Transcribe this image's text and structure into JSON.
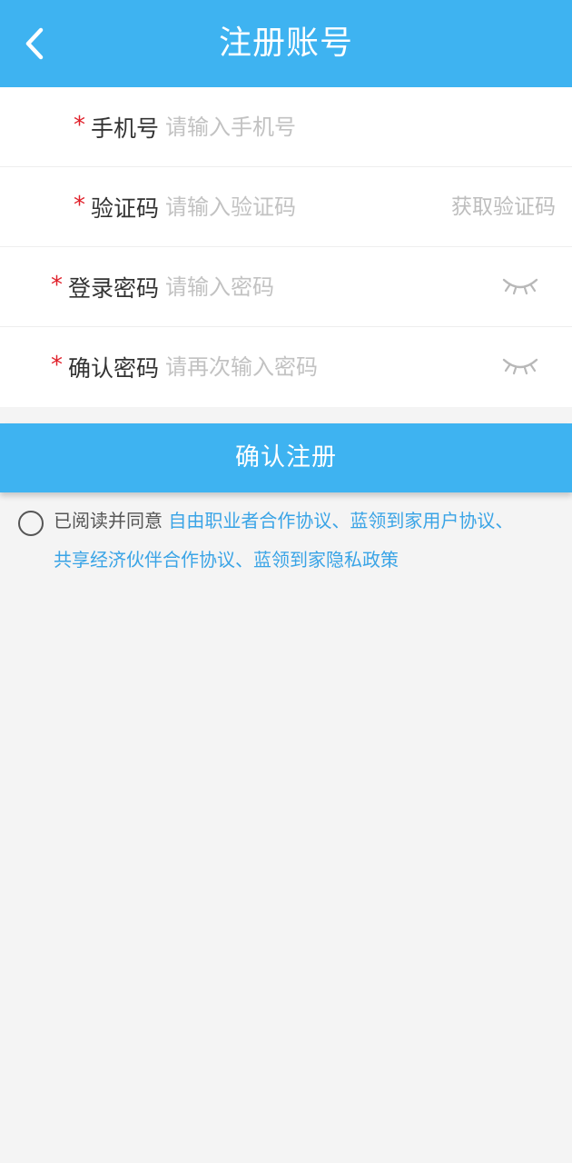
{
  "header": {
    "title": "注册账号",
    "back_icon": "chevron-left-icon",
    "background": "#3eb3f1"
  },
  "form": {
    "required_mark": "*",
    "phone": {
      "label": "手机号",
      "placeholder": "请输入手机号"
    },
    "code": {
      "label": "验证码",
      "placeholder": "请输入验证码",
      "get_code": "获取验证码"
    },
    "password": {
      "label": "登录密码",
      "placeholder": "请输入密码",
      "toggle_icon": "eye-closed-icon"
    },
    "confirm": {
      "label": "确认密码",
      "placeholder": "请再次输入密码",
      "toggle_icon": "eye-closed-icon"
    }
  },
  "submit": {
    "label": "确认注册"
  },
  "agreement": {
    "prefix": "已阅读并同意 ",
    "links": [
      "自由职业者合作协议",
      "蓝领到家用户协议",
      "共享经济伙伴合作协议",
      "蓝领到家隐私政策"
    ],
    "separator": "、",
    "checked": false
  }
}
